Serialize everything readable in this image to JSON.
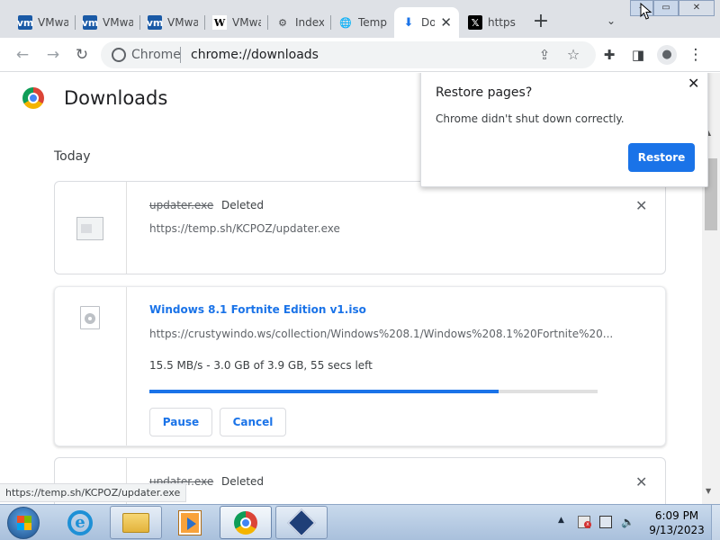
{
  "tabs": [
    {
      "title": "VMware",
      "favicon": "vmware-icon"
    },
    {
      "title": "VMware",
      "favicon": "vmware-icon"
    },
    {
      "title": "VMware",
      "favicon": "vmware-icon"
    },
    {
      "title": "VMware",
      "favicon": "wikipedia-icon"
    },
    {
      "title": "Index",
      "favicon": "index-icon"
    },
    {
      "title": "Temp",
      "favicon": "globe-icon"
    },
    {
      "title": "Downloads",
      "favicon": "download-icon",
      "active": true
    },
    {
      "title": "https",
      "favicon": "x-icon"
    }
  ],
  "omnibox": {
    "site_label": "Chrome",
    "url": "chrome://downloads"
  },
  "page": {
    "title": "Downloads",
    "section": "Today"
  },
  "downloads": [
    {
      "filename": "updater.exe",
      "state": "Deleted",
      "url": "https://temp.sh/KCPOZ/updater.exe"
    },
    {
      "filename": "Windows 8.1 Fortnite Edition v1.iso",
      "url": "https://crustywindo.ws/collection/Windows%208.1/Windows%208.1%20Fortnite%20...",
      "status": "15.5 MB/s - 3.0 GB of 3.9 GB, 55 secs left",
      "progress": 0.78,
      "pause_label": "Pause",
      "cancel_label": "Cancel"
    },
    {
      "filename": "updater.exe",
      "state": "Deleted"
    }
  ],
  "restore_bubble": {
    "title": "Restore pages?",
    "message": "Chrome didn't shut down correctly.",
    "button": "Restore"
  },
  "status_bar": {
    "text": "https://temp.sh/KCPOZ/updater.exe"
  },
  "taskbar": {
    "time": "6:09 PM",
    "date": "9/13/2023"
  },
  "colors": {
    "accent": "#1a73e8",
    "progress_track": "#e0e0e0"
  }
}
